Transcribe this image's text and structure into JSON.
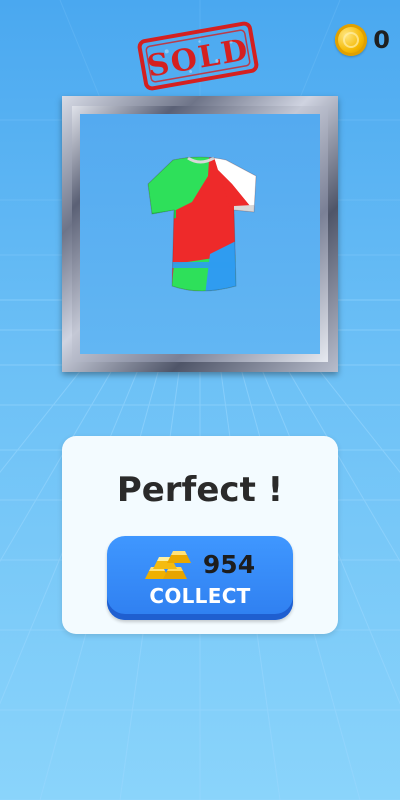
{
  "hud": {
    "coin_icon": "gold-coin-icon",
    "coins": "0"
  },
  "stamp": {
    "text": "SOLD",
    "color": "#d42020"
  },
  "frame": {
    "artwork": "painted-tshirt",
    "shirt_colors": [
      "#2ee05a",
      "#ee2a2a",
      "#ffffff",
      "#2f9cf0"
    ]
  },
  "result": {
    "title": "Perfect !",
    "reward_icon": "gold-bars-icon",
    "reward_amount": "954",
    "collect_label": "COLLECT"
  },
  "colors": {
    "button": "#3a8cff",
    "panel": "#f3fbff",
    "background": "#6cc0f6"
  }
}
